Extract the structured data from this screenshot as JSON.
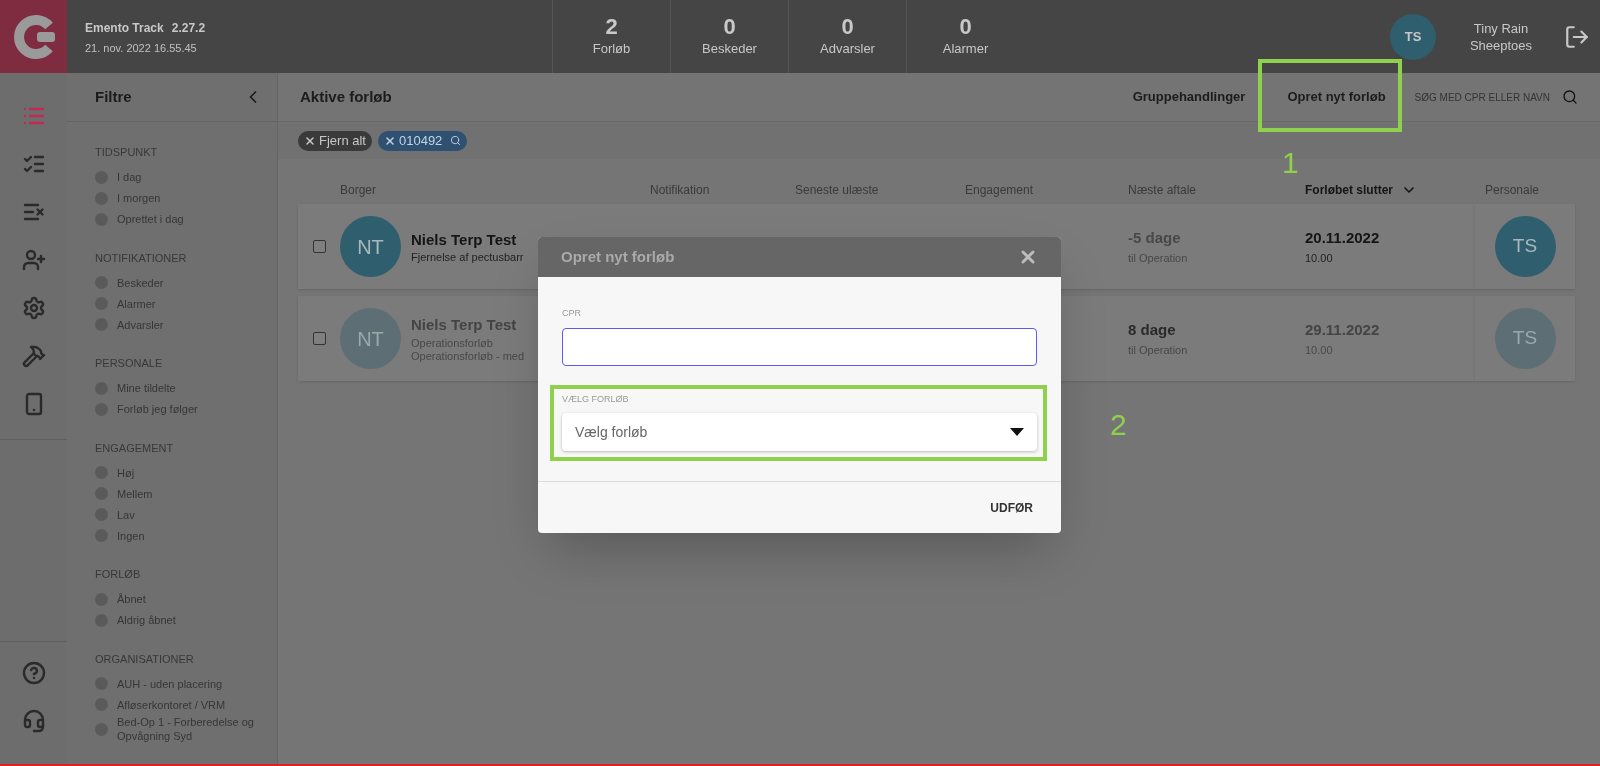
{
  "app": {
    "name": "Emento Track",
    "version": "2.27.2",
    "datetime": "21. nov. 2022 16.55.45"
  },
  "stats": [
    {
      "value": "2",
      "label": "Forløb"
    },
    {
      "value": "0",
      "label": "Beskeder"
    },
    {
      "value": "0",
      "label": "Advarsler"
    },
    {
      "value": "0",
      "label": "Alarmer"
    }
  ],
  "user": {
    "initials": "TS",
    "name_lines": [
      "Tiny Rain",
      "Sheeptoes"
    ]
  },
  "nav": [
    {
      "kind": "list",
      "selected": true
    },
    {
      "kind": "list-check",
      "selected": false
    },
    {
      "kind": "list-x",
      "selected": false
    },
    {
      "kind": "user-plus",
      "selected": false
    },
    {
      "kind": "settings",
      "selected": false
    },
    {
      "kind": "hammer",
      "selected": false
    },
    {
      "kind": "phone",
      "selected": false
    }
  ],
  "nav_bottom": [
    {
      "kind": "help"
    },
    {
      "kind": "headset"
    }
  ],
  "filters": {
    "title": "Filtre",
    "sections": [
      {
        "title": "TIDSPUNKT",
        "options": [
          {
            "label": "I dag",
            "selected": false
          },
          {
            "label": "I morgen",
            "selected": false
          },
          {
            "label": "Oprettet i dag",
            "selected": false
          }
        ]
      },
      {
        "title": "NOTIFIKATIONER",
        "options": [
          {
            "label": "Beskeder",
            "selected": false
          },
          {
            "label": "Alarmer",
            "selected": false
          },
          {
            "label": "Advarsler",
            "selected": false
          }
        ]
      },
      {
        "title": "PERSONALE",
        "options": [
          {
            "label": "Mine tildelte",
            "selected": false
          },
          {
            "label": "Forløb jeg følger",
            "selected": false
          }
        ]
      },
      {
        "title": "ENGAGEMENT",
        "options": [
          {
            "label": "Høj",
            "selected": false
          },
          {
            "label": "Mellem",
            "selected": false
          },
          {
            "label": "Lav",
            "selected": false
          },
          {
            "label": "Ingen",
            "selected": false
          }
        ]
      },
      {
        "title": "FORLØB",
        "options": [
          {
            "label": "Åbnet",
            "selected": false
          },
          {
            "label": "Aldrig åbnet",
            "selected": false
          }
        ]
      },
      {
        "title": "ORGANISATIONER",
        "options": [
          {
            "label": "AUH - uden placering",
            "selected": false
          },
          {
            "label": "Afløserkontoret / VRM",
            "selected": false
          },
          {
            "label": "Bed-Op 1 - Forberedelse og Opvågning Syd",
            "selected": false
          }
        ]
      }
    ]
  },
  "main": {
    "title": "Aktive forløb",
    "actions": [
      "Gruppehandlinger",
      "Opret nyt forløb"
    ],
    "search_placeholder": "SØG MED CPR ELLER NAVN"
  },
  "chips": [
    {
      "kind": "clear",
      "label": "Fjern alt"
    },
    {
      "kind": "search",
      "label": "010492"
    }
  ],
  "table": {
    "columns": [
      {
        "label": "Borger",
        "sorted": false
      },
      {
        "label": "Notifikation",
        "sorted": false
      },
      {
        "label": "Seneste ulæste",
        "sorted": false
      },
      {
        "label": "Engagement",
        "sorted": false
      },
      {
        "label": "Næste aftale",
        "sorted": false
      },
      {
        "label": "Forløbet slutter",
        "sorted": true
      },
      {
        "label": "Personale",
        "sorted": false
      }
    ],
    "rows": [
      {
        "checked": false,
        "muted": false,
        "initials": "NT",
        "name": "Niels Terp Test",
        "lines": [
          "Fjernelse af pectusbarr"
        ],
        "next": "-5 dage",
        "next_label": "til Operation",
        "end_date": "20.11.2022",
        "end_time": "10.00",
        "staff": "TS"
      },
      {
        "checked": false,
        "muted": true,
        "initials": "NT",
        "name": "Niels Terp Test",
        "lines": [
          "Operationsforløb",
          "Operationsforløb - med"
        ],
        "next": "8 dage",
        "next_label": "til Operation",
        "end_date": "29.11.2022",
        "end_time": "10.00",
        "staff": "TS"
      }
    ]
  },
  "dialog": {
    "title": "Opret nyt forløb",
    "cpr_label": "CPR",
    "select_label": "VÆLG FORLØB",
    "select_placeholder": "Vælg forløb",
    "submit": "UDFØR"
  },
  "annotations": [
    {
      "label": "1"
    },
    {
      "label": "2"
    }
  ]
}
